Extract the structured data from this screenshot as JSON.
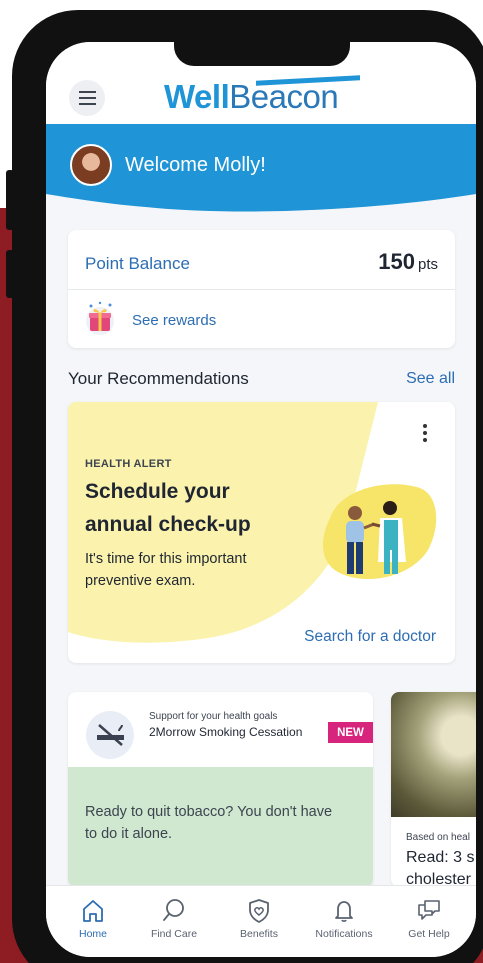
{
  "header": {
    "logo_bold": "Well",
    "logo_regular": "Beacon"
  },
  "welcome": {
    "greeting": "Welcome Molly!"
  },
  "points": {
    "label": "Point Balance",
    "value": "150",
    "unit": "pts",
    "rewards_link": "See rewards"
  },
  "recommendations": {
    "title": "Your Recommendations",
    "see_all": "See all",
    "health_alert": {
      "tag": "HEALTH ALERT",
      "title": "Schedule your annual check-up",
      "body": "It's time for this important preventive exam.",
      "link": "Search for a doctor"
    },
    "program_card": {
      "subtitle": "Support for your health goals",
      "name": "2Morrow Smoking Cessation",
      "badge": "NEW",
      "body": "Ready to quit tobacco? You don't have to do it alone."
    },
    "article_card": {
      "subtitle": "Based on heal",
      "title_line1": "Read: 3 s",
      "title_line2": "cholester"
    }
  },
  "tabs": [
    {
      "label": "Home",
      "icon": "home-icon",
      "active": true
    },
    {
      "label": "Find Care",
      "icon": "search-icon",
      "active": false
    },
    {
      "label": "Benefits",
      "icon": "shield-heart-icon",
      "active": false
    },
    {
      "label": "Notifications",
      "icon": "bell-icon",
      "active": false
    },
    {
      "label": "Get Help",
      "icon": "chat-icon",
      "active": false
    }
  ],
  "colors": {
    "brand_blue": "#1f94d6",
    "link_blue": "#2c6db3",
    "alert_yellow": "#fbf3ad",
    "badge_pink": "#d7247c",
    "program_green": "#cfe8cf",
    "backdrop_red": "#8e1d23"
  }
}
